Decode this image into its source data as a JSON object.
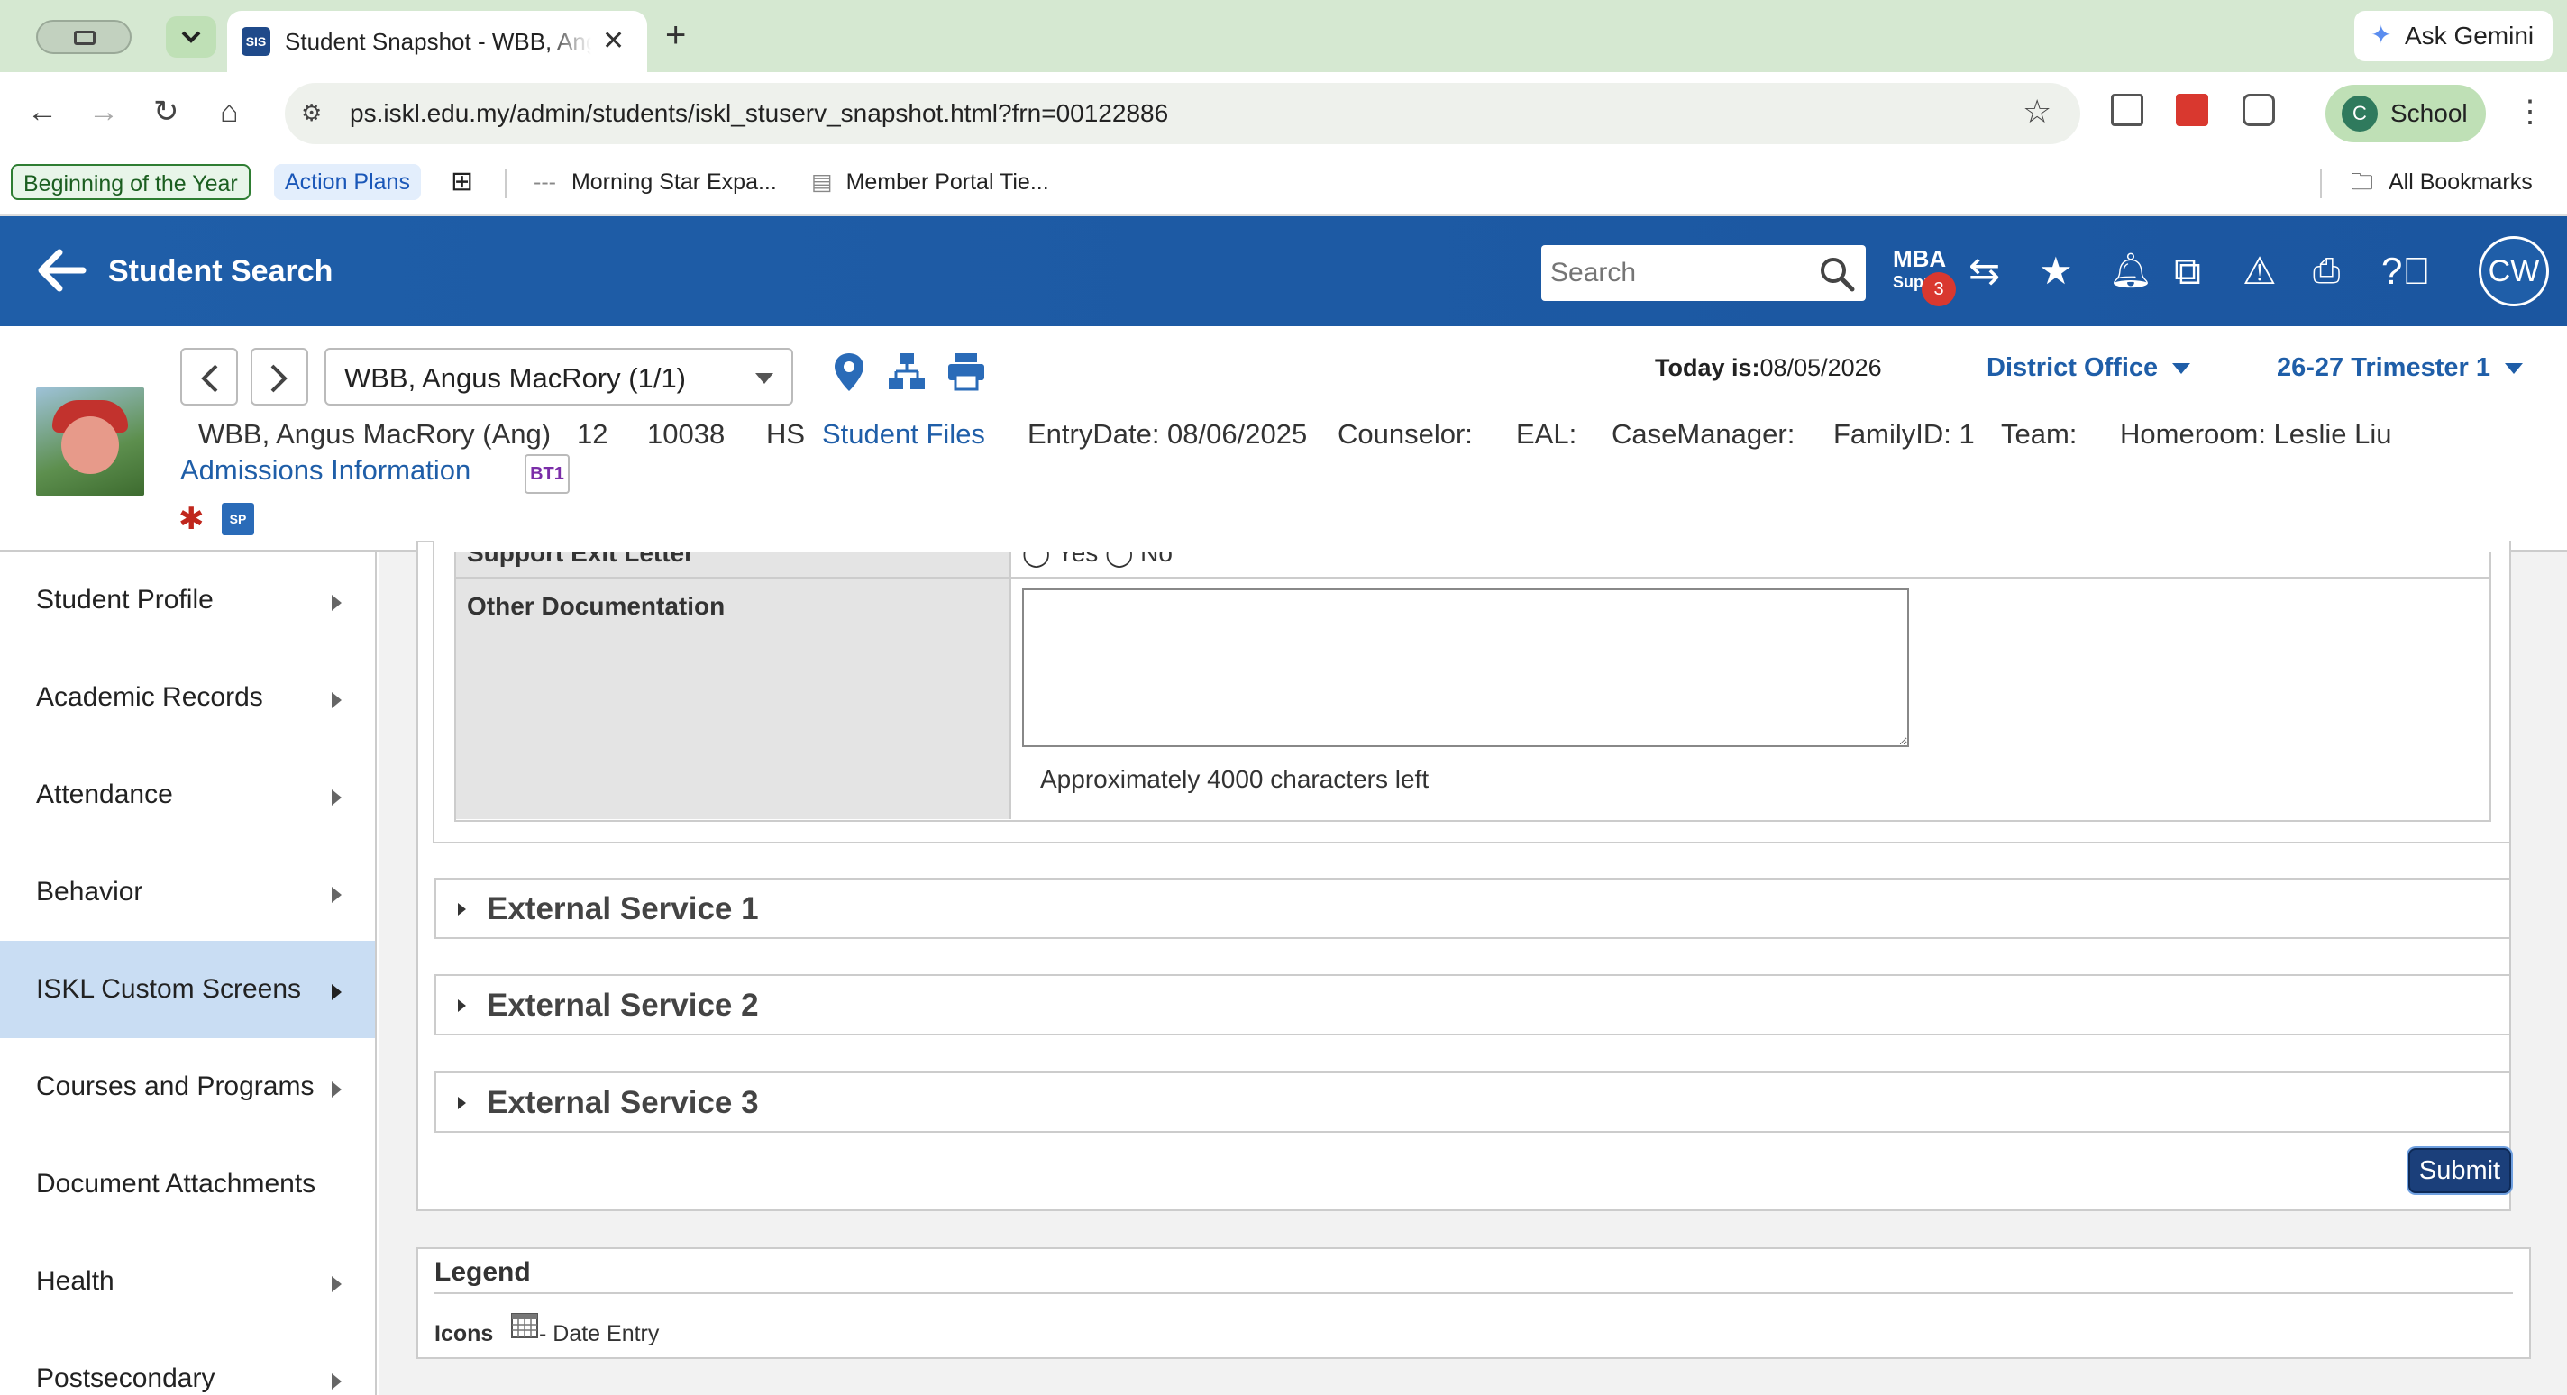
{
  "browser": {
    "tab_title": "Student Snapshot - WBB, Angus MacRory",
    "tab_favicon": "SIS",
    "ask_gemini": "Ask Gemini",
    "url": "ps.iskl.edu.my/admin/students/iskl_stuserv_snapshot.html?frn=00122886",
    "profile_initial": "C",
    "profile_name": "School",
    "bookmarks": [
      "Beginning of the Year",
      "Action Plans",
      "Morning Star Expa...",
      "Member Portal Tie...",
      "All Bookmarks"
    ]
  },
  "header": {
    "back_label": "Student Search",
    "search_placeholder": "Search",
    "mba_line1": "MBA",
    "mba_line2": "Supp",
    "notification_count": "3",
    "user_initials": "CW"
  },
  "student": {
    "selector": "WBB, Angus MacRory  (1/1)",
    "today_label": "Today is:",
    "today_value": "08/05/2026",
    "school": "District Office",
    "term": "26-27 Trimester 1",
    "name": "WBB, Angus MacRory (Ang)",
    "grade": "12",
    "id": "10038",
    "level": "HS",
    "files_link": "Student Files",
    "entry_date": "EntryDate: 08/06/2025",
    "counselor": "Counselor:",
    "eal": "EAL:",
    "case_manager": "CaseManager:",
    "family_id": "FamilyID: 1",
    "team": "Team:",
    "homeroom": "Homeroom: Leslie Liu",
    "admissions_link": "Admissions Information",
    "bt1_badge": "BT1",
    "sp_badge": "SP"
  },
  "sidebar": {
    "items": [
      {
        "label": "Student Profile",
        "arrow": true,
        "active": false
      },
      {
        "label": "Academic Records",
        "arrow": true,
        "active": false
      },
      {
        "label": "Attendance",
        "arrow": true,
        "active": false
      },
      {
        "label": "Behavior",
        "arrow": true,
        "active": false
      },
      {
        "label": "ISKL Custom Screens",
        "arrow": true,
        "active": true
      },
      {
        "label": "Courses and Programs",
        "arrow": true,
        "active": false
      },
      {
        "label": "Document Attachments",
        "arrow": false,
        "active": false
      },
      {
        "label": "Health",
        "arrow": true,
        "active": false
      },
      {
        "label": "Postsecondary",
        "arrow": true,
        "active": false
      }
    ]
  },
  "form": {
    "cut_row_label": "Support Exit Letter",
    "cut_row_options": "◯ Yes  ◯ No",
    "other_doc_label": "Other Documentation",
    "other_doc_value": "",
    "chars_left": "Approximately 4000 characters left",
    "sections": [
      "External Service 1",
      "External Service 2",
      "External Service 3"
    ],
    "submit_label": "Submit"
  },
  "legend": {
    "title": "Legend",
    "icons_label": "Icons",
    "date_entry": "- Date Entry"
  },
  "colors": {
    "header_blue": "#1f5ea8",
    "active_nav": "#c9ddf3",
    "submit_bg": "#1b3f7a",
    "chrome_green": "#d5e8d1"
  }
}
